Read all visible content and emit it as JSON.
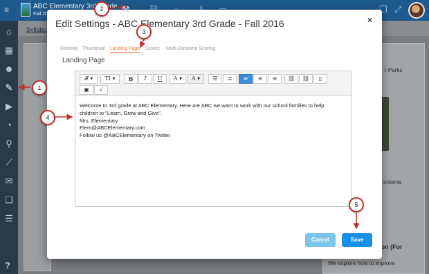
{
  "app": {
    "course_title": "ABC Elementary 3rd Grade",
    "course_subtitle": "Fall 201",
    "menu_icon": "≡",
    "top_icons": [
      "wrench-icon",
      "link-icon",
      "search-icon",
      "person-icon",
      "archive-icon",
      "copy-icon",
      "expand-icon"
    ],
    "syllabus_tab": "Syllabus",
    "help": "?"
  },
  "right_panel": {
    "parks_text": "r Parks",
    "contents_text": "ontents",
    "heading": "ation (For",
    "body": "We explore how to improve"
  },
  "modal": {
    "title": "Edit Settings - ABC Elementary 3rd Grade - Fall 2016",
    "close": "×",
    "tabs": [
      "General",
      "Thumbnail",
      "Landing Page",
      "Scores",
      "Multi-Outcome Scoring"
    ],
    "active_tab": "Landing Page",
    "section_title": "Landing Page",
    "toolbar": {
      "font_label": "𝓕 ▾",
      "size_label": "TI ▾",
      "bold": "B",
      "italic": "I",
      "underline": "U",
      "color_label": "A ▾",
      "bg_color_label": "A ▾"
    },
    "editor_lines": [
      "Welcome to 3rd grade at ABC Elementary. Here are ABC we want to work with our school families to help",
      "children to \"Learn, Grow and Give\".",
      "Mrs. Elementary",
      "Elem@ABCElementary.com",
      "Follow us @ABCElementary on Twitter"
    ],
    "cancel_label": "Cancel",
    "save_label": "Save"
  },
  "callouts": [
    "1",
    "2",
    "3",
    "4",
    "5"
  ],
  "colors": {
    "topbar": "#1f5a8e",
    "sidebar": "#2a3a4a",
    "active_tab": "#f07a3a",
    "save": "#1a8fe6",
    "cancel": "#7bc4ec",
    "callout_border": "#c0322b"
  }
}
